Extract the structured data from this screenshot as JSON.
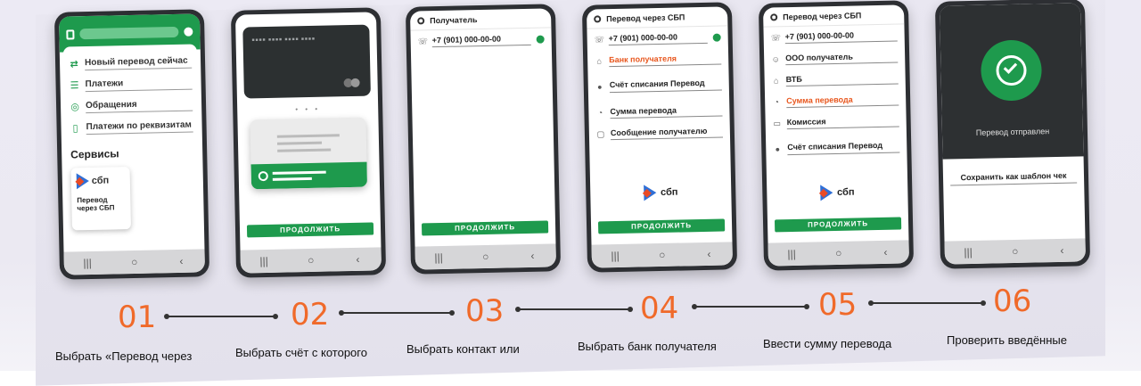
{
  "colors": {
    "brand_green": "#1e9a4d",
    "accent_orange": "#f06a2a",
    "phone_frame": "#2d2f33"
  },
  "icons": [
    "lock-icon",
    "phone-icon",
    "bank-icon",
    "person-icon",
    "money-icon",
    "document-icon",
    "check-icon",
    "square-nav-icon",
    "circle-nav-icon",
    "back-nav-icon"
  ],
  "navbar": {
    "left": "|||",
    "center": "○",
    "right": "‹"
  },
  "phone1": {
    "menu": [
      "Новый перевод сейчас",
      "Платежи",
      "Обращения",
      "Платежи по реквизитам"
    ],
    "section_title": "Сервисы",
    "sbp_logo": "сбп",
    "sbp_caption": "Перевод через СБП"
  },
  "phone2": {
    "button": "ПРОДОЛЖИТЬ"
  },
  "phone3": {
    "header": "Получатель",
    "phone_value": "+7 (901) 000-00-00",
    "button": "ПРОДОЛЖИТЬ"
  },
  "phone4": {
    "header": "Перевод через СБП",
    "phone_value": "+7 (901) 000-00-00",
    "bank_field": "Банк получателя",
    "account_field": "Счёт списания Перевод",
    "amount_field": "Сумма перевода",
    "message_field": "Сообщение получателю",
    "sbp_logo": "сбп",
    "button": "ПРОДОЛЖИТЬ"
  },
  "phone5": {
    "header": "Перевод через СБП",
    "phone_value": "+7 (901) 000-00-00",
    "recipient_field": "ООО получатель",
    "bank_field": "ВТБ",
    "amount_field": "Сумма перевода",
    "comment_field": "Комиссия",
    "account_field": "Счёт списания Перевод",
    "sbp_logo": "сбп",
    "button": "ПРОДОЛЖИТЬ"
  },
  "phone6": {
    "title": "Перевод отправлен",
    "link": "Сохранить как шаблон чек"
  },
  "steps": [
    {
      "num": "01",
      "caption": "Выбрать «Перевод через"
    },
    {
      "num": "02",
      "caption": "Выбрать счёт с которого"
    },
    {
      "num": "03",
      "caption": "Выбрать контакт или"
    },
    {
      "num": "04",
      "caption": "Выбрать банк получателя"
    },
    {
      "num": "05",
      "caption": "Ввести сумму перевода"
    },
    {
      "num": "06",
      "caption": "Проверить введённые"
    }
  ]
}
